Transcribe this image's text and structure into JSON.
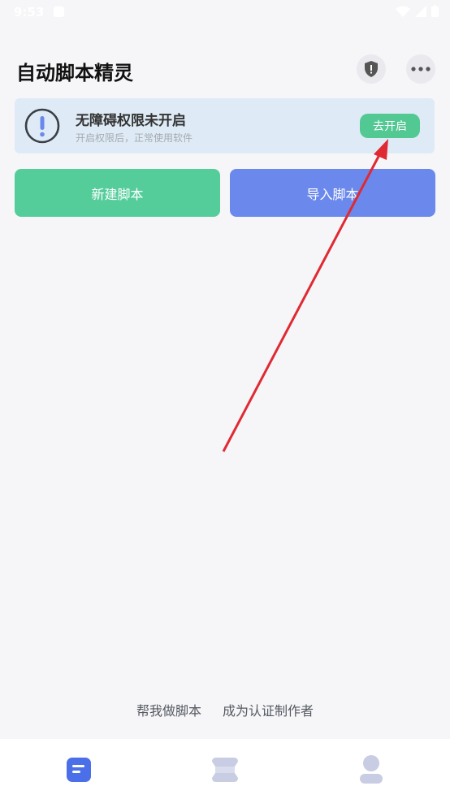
{
  "status_bar": {
    "time": "9:53"
  },
  "header": {
    "title": "自动脚本精灵"
  },
  "banner": {
    "title": "无障碍权限未开启",
    "subtitle": "开启权限后，正常使用软件",
    "button_label": "去开启"
  },
  "actions": {
    "new_label": "新建脚本",
    "import_label": "导入脚本"
  },
  "footer": {
    "help_label": "帮我做脚本",
    "author_label": "成为认证制作者"
  },
  "nav": {
    "icons": [
      "script-list-icon",
      "layers-icon",
      "person-icon"
    ],
    "active_index": 0
  },
  "colors": {
    "accent_green": "#52c893",
    "accent_blue": "#6b88ec",
    "banner_bg": "#deebf6",
    "nav_active": "#4a6fe8",
    "nav_inactive": "#c9cde3",
    "annotation_arrow": "#e02a33"
  }
}
